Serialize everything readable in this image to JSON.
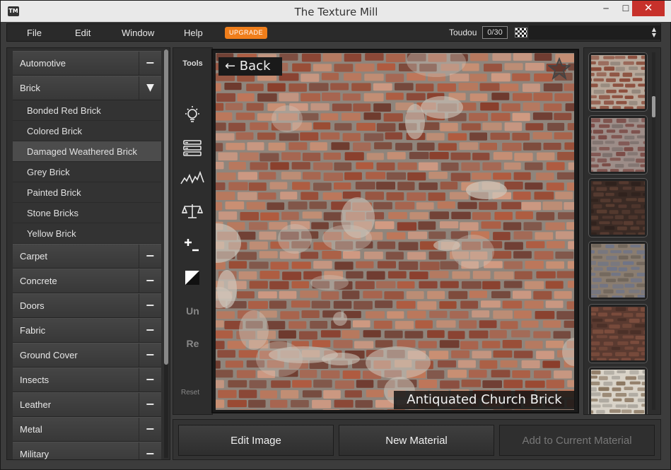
{
  "window": {
    "title": "The Texture Mill",
    "app_icon": "TM"
  },
  "menu": {
    "items": [
      "File",
      "Edit",
      "Window",
      "Help"
    ],
    "upgrade_label": "UPGRADE",
    "user_name": "Toudou",
    "count": "0/30",
    "upgrade_color": "#f07e1b"
  },
  "sidebar": {
    "categories_top": [
      {
        "label": "Automotive",
        "toggle": "−"
      }
    ],
    "expanded": {
      "label": "Brick",
      "toggle": "▼",
      "items": [
        "Bonded Red Brick",
        "Colored Brick",
        "Damaged Weathered Brick",
        "Grey Brick",
        "Painted Brick",
        "Stone Bricks",
        "Yellow Brick"
      ],
      "selected_index": 2
    },
    "categories_bottom": [
      {
        "label": "Carpet",
        "toggle": "−"
      },
      {
        "label": "Concrete",
        "toggle": "−"
      },
      {
        "label": "Doors",
        "toggle": "−"
      },
      {
        "label": "Fabric",
        "toggle": "−"
      },
      {
        "label": "Ground Cover",
        "toggle": "−"
      },
      {
        "label": "Insects",
        "toggle": "−"
      },
      {
        "label": "Leather",
        "toggle": "−"
      },
      {
        "label": "Metal",
        "toggle": "−"
      },
      {
        "label": "Military",
        "toggle": "−"
      }
    ]
  },
  "tools": {
    "title": "Tools",
    "icons": [
      "lightbulb-icon",
      "layers-icon",
      "waveform-icon",
      "balance-scale-icon",
      "plus-minus-icon",
      "contrast-icon"
    ],
    "undo_label": "Un",
    "redo_label": "Re",
    "reset_label": "Reset"
  },
  "viewer": {
    "back_label": "← Back",
    "caption": "Antiquated Church Brick",
    "favorite_icon": "star-icon"
  },
  "thumbnails": [
    {
      "name": "thumb-red-brick",
      "base": "#8a4b3a",
      "mortar": "#b8a89a"
    },
    {
      "name": "thumb-dark-red-brick",
      "base": "#7a4a45",
      "mortar": "#9d8d88"
    },
    {
      "name": "thumb-brown-brick",
      "base": "#5a3d32",
      "mortar": "#3a2a24"
    },
    {
      "name": "thumb-grey-brick",
      "base": "#6e7488",
      "mortar": "#8a7d70"
    },
    {
      "name": "thumb-painted-brick",
      "base": "#7d4e3e",
      "mortar": "#5a3a30"
    },
    {
      "name": "thumb-stone-brick",
      "base": "#8a7660",
      "mortar": "#d9d3c8"
    }
  ],
  "actions": {
    "edit_image": "Edit Image",
    "new_material": "New Material",
    "add_to_material": "Add to Current Material"
  }
}
